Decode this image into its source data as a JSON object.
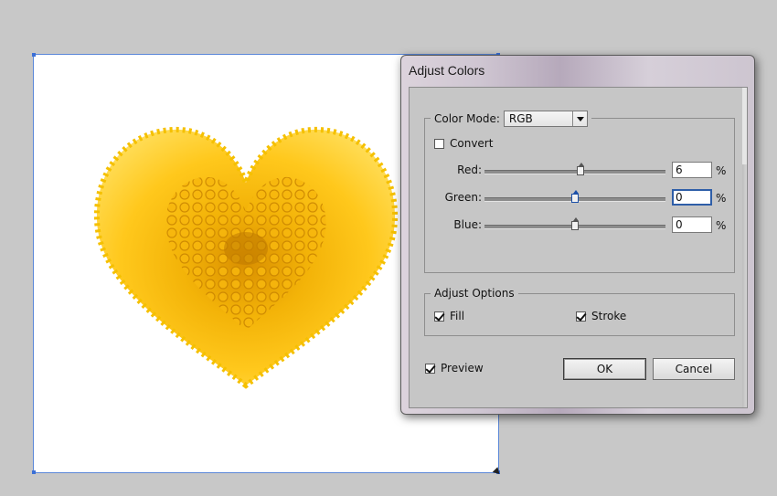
{
  "dialog": {
    "title": "Adjust Colors",
    "color_mode": {
      "label": "Color Mode:",
      "selected": "RGB"
    },
    "convert": {
      "label": "Convert",
      "checked": false
    },
    "sliders": [
      {
        "label": "Red:",
        "value": "6",
        "unit": "%",
        "level": 0.53
      },
      {
        "label": "Green:",
        "value": "0",
        "unit": "%",
        "level": 0.5
      },
      {
        "label": "Blue:",
        "value": "0",
        "unit": "%",
        "level": 0.5
      }
    ],
    "adjust_options": {
      "legend": "Adjust Options",
      "fill": {
        "label": "Fill",
        "checked": true
      },
      "stroke": {
        "label": "Stroke",
        "checked": true
      }
    },
    "preview": {
      "label": "Preview",
      "checked": true
    },
    "ok_label": "OK",
    "cancel_label": "Cancel"
  },
  "colors": {
    "workspace": "#c8c8c8",
    "artboard_outline": "#5b87d8",
    "heart_dark": "#e0a100",
    "heart_light": "#ffd23a"
  }
}
